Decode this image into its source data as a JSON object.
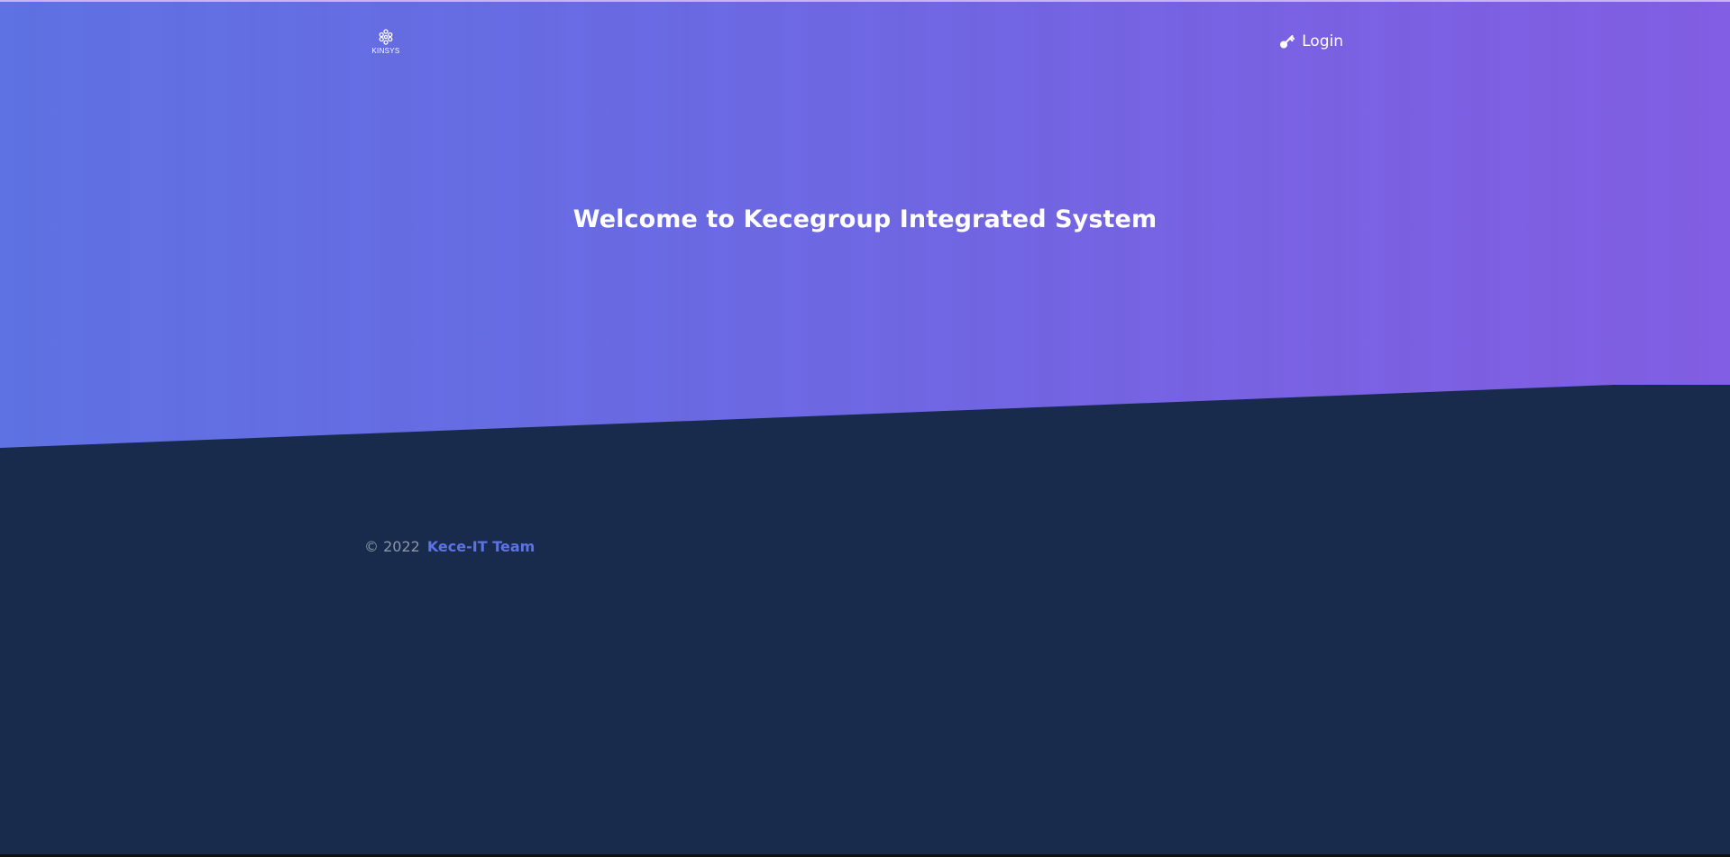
{
  "brand": {
    "name": "KINSYS",
    "icon": "flower-logo-icon"
  },
  "nav": {
    "login_label": "Login",
    "login_icon": "key-icon"
  },
  "hero": {
    "title": "Welcome to Kecegroup Integrated System"
  },
  "footer": {
    "copyright": "© 2022",
    "team_link": "Kece-IT Team"
  },
  "colors": {
    "hero_gradient_start": "#5f72e4",
    "hero_gradient_end": "#825ee4",
    "background_dark": "#172b4d",
    "link_accent": "#5e72e4",
    "muted_text": "#8898aa"
  }
}
